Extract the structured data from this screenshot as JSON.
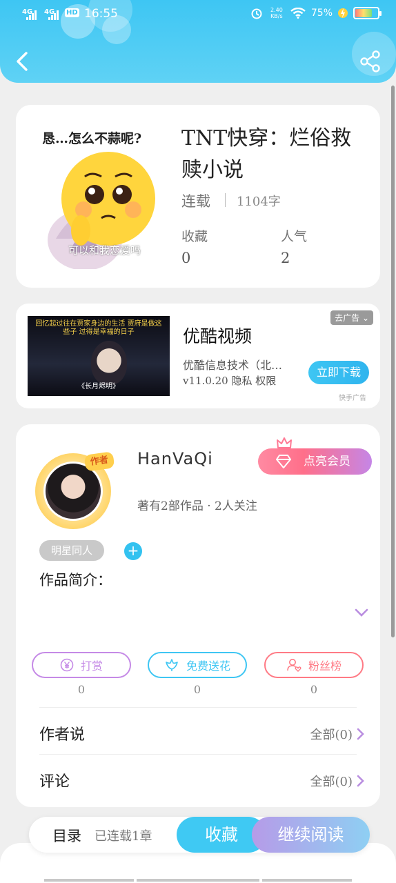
{
  "status_bar": {
    "signal1": "4G",
    "signal2": "4G",
    "hd": "HD",
    "time": "16:55",
    "net_speed": "2.40 KB/s",
    "battery": "75%"
  },
  "header": {
    "back_icon": "back-arrow-icon",
    "share_icon": "share-icon",
    "accent": "#3ec6f3"
  },
  "book": {
    "cover_top_text": "恳…怎么不蒜呢?",
    "cover_bottom_text": "可以和我恋爱吗",
    "title": "TNT快穿：烂俗救赎小说",
    "status": "连载",
    "word_count": "1104字",
    "favorites_label": "收藏",
    "favorites_value": "0",
    "popularity_label": "人气",
    "popularity_value": "2"
  },
  "ad": {
    "thumb_caption_top": "回忆起过往在贾家身边的生活 贾府是做这些子 过得是幸福的日子",
    "thumb_caption_bottom": "《长月烬明》",
    "app_name": "优酷视频",
    "company": "优酷信息技术（北…",
    "version": "v11.0.20 隐私 权限",
    "remove_ad": "去广告",
    "download": "立即下载",
    "source": "快手广告"
  },
  "author": {
    "badge": "作者",
    "name": "HanVaQi",
    "vip_button": "点亮会员",
    "meta": "著有2部作品 · 2人关注",
    "tag": "明星同人",
    "add_tag": "+",
    "intro_label": "作品简介：",
    "actions": [
      {
        "label": "打赏",
        "count": "0",
        "color": "#c58ae6"
      },
      {
        "label": "免费送花",
        "count": "0",
        "color": "#3ec6f3"
      },
      {
        "label": "粉丝榜",
        "count": "0",
        "color": "#ff7a85"
      }
    ],
    "author_says_label": "作者说",
    "author_says_all": "全部(0)",
    "comments_label": "评论",
    "comments_all": "全部(0)"
  },
  "bottom_bar": {
    "toc": "目录",
    "chapters": "已连载1章",
    "collect": "收藏",
    "continue_reading": "继续阅读"
  }
}
